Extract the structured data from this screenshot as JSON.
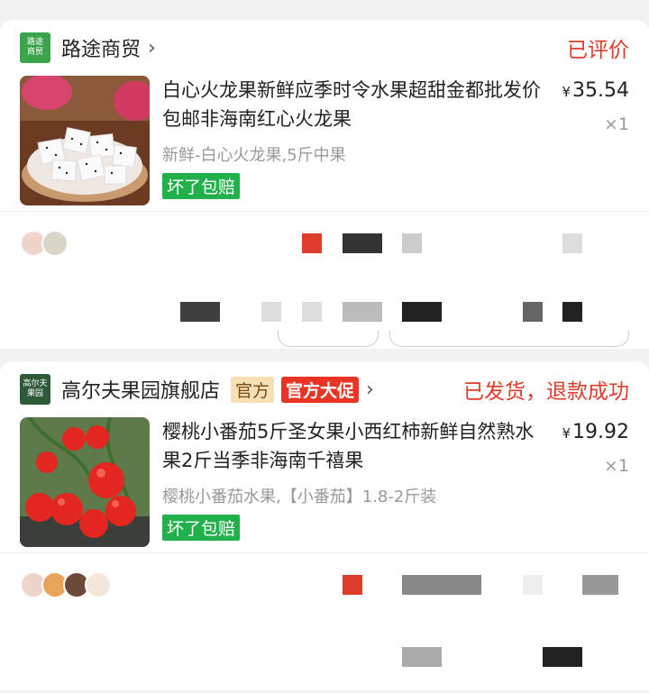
{
  "orders": [
    {
      "shop_logo_text": [
        "路途",
        "商贸"
      ],
      "shop_name": "路途商贸",
      "status": "已评价",
      "title": "白心火龙果新鲜应季时令水果超甜金都批发价包邮非海南红心火龙果",
      "spec": "新鲜-白心火龙果,5斤中果",
      "tag": "坏了包赔",
      "currency": "¥",
      "price": "35.54",
      "qty": "×1"
    },
    {
      "shop_logo_text": [
        "高尔夫",
        "果园"
      ],
      "shop_name": "高尔夫果园旗舰店",
      "badge_official": "官方",
      "badge_promo": "官方大促",
      "status": "已发货，退款成功",
      "title": "樱桃小番茄5斤圣女果小西红柿新鲜自然熟水果2斤当季非海南千禧果",
      "spec": "樱桃小番茄水果,【小番茄】1.8-2斤装",
      "tag": "坏了包赔",
      "currency": "¥",
      "price": "19.92",
      "qty": "×1"
    }
  ],
  "colors": {
    "status_red": "#e03c2b",
    "tag_green": "#21b04b",
    "promo_red": "#ea3323"
  },
  "icons": {
    "chevron": "chevron-right-icon"
  }
}
